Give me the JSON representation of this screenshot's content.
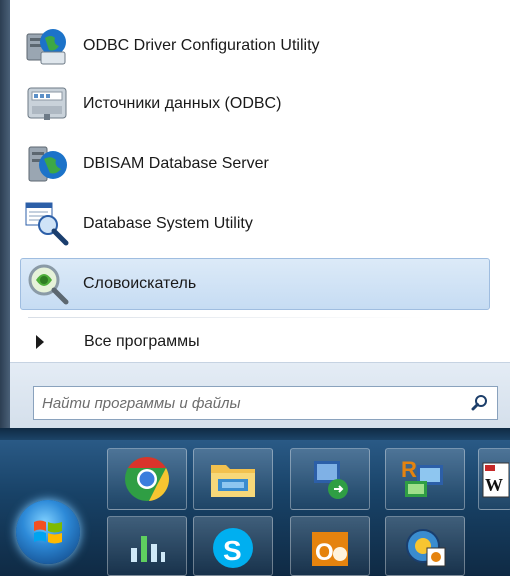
{
  "start_menu": {
    "programs": [
      {
        "label": "ODBC Driver Configuration Utility",
        "icon": "computer-globe-icon"
      },
      {
        "label": "Источники данных (ODBC)",
        "icon": "data-sources-icon"
      },
      {
        "label": "DBISAM Database Server",
        "icon": "server-globe-icon"
      },
      {
        "label": "Database System Utility",
        "icon": "database-magnifier-icon"
      },
      {
        "label": "Словоискатель",
        "icon": "word-search-magnifier-icon"
      }
    ],
    "all_programs_label": "Все программы",
    "search": {
      "placeholder": "Найти программы и файлы"
    }
  },
  "taskbar": {
    "pinned": [
      {
        "name": "chrome-icon"
      },
      {
        "name": "file-explorer-icon"
      },
      {
        "name": "network-app-icon"
      },
      {
        "name": "remote-desktop-icon"
      },
      {
        "name": "word-app-icon"
      },
      {
        "name": "equalizer-app-icon"
      },
      {
        "name": "skype-icon"
      },
      {
        "name": "outlook-icon"
      },
      {
        "name": "picture-viewer-icon"
      }
    ]
  },
  "colors": {
    "selection": "#c6dcf3",
    "taskbar": "#184267",
    "chrome_green": "#2f9e44",
    "chrome_red": "#d9342b",
    "chrome_yellow": "#f7c531",
    "skype_blue": "#00aff0",
    "outlook_orange": "#e5830e"
  }
}
